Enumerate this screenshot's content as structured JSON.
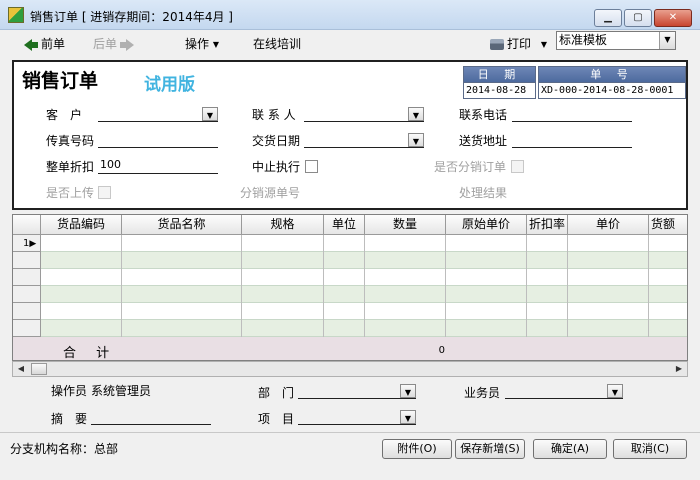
{
  "window": {
    "title": "销售订单 [ 进销存期间：2014年4月 ]"
  },
  "toolbar": {
    "prev": "前单",
    "next": "后单",
    "operations": "操作",
    "training": "在线培训",
    "print": "打印",
    "template": "标准模板"
  },
  "form": {
    "title": "销售订单",
    "trial": "试用版",
    "date_caption": "日 期",
    "date_value": "2014-08-28",
    "number_caption": "单 号",
    "number_value": "XD-000-2014-08-28-0001",
    "customer_label": "客　户",
    "contact_label": "联 系 人",
    "phone_label": "联系电话",
    "fax_label": "传真号码",
    "delivery_date_label": "交货日期",
    "address_label": "送货地址",
    "discount_label": "整单折扣",
    "discount_value": "100",
    "suspend_label": "中止执行",
    "distribution_label": "是否分销订单",
    "uploaded_label": "是否上传",
    "source_label": "分销源单号",
    "result_label": "处理结果"
  },
  "grid": {
    "columns": [
      "货品编码",
      "货品名称",
      "规格",
      "单位",
      "数量",
      "原始单价",
      "折扣率",
      "单价",
      "货额"
    ],
    "first_row_number": "1",
    "total_label": "合 计",
    "total_qty": "0"
  },
  "bottom": {
    "operator_label": "操作员",
    "operator_value": "系统管理员",
    "dept_label": "部　门",
    "salesman_label": "业务员",
    "summary_label": "摘　要",
    "project_label": "项　目",
    "branch": "分支机构名称：总部"
  },
  "buttons": {
    "attach": "附件(O)",
    "save_new": "保存新增(S)",
    "ok": "确定(A)",
    "cancel": "取消(C)"
  }
}
